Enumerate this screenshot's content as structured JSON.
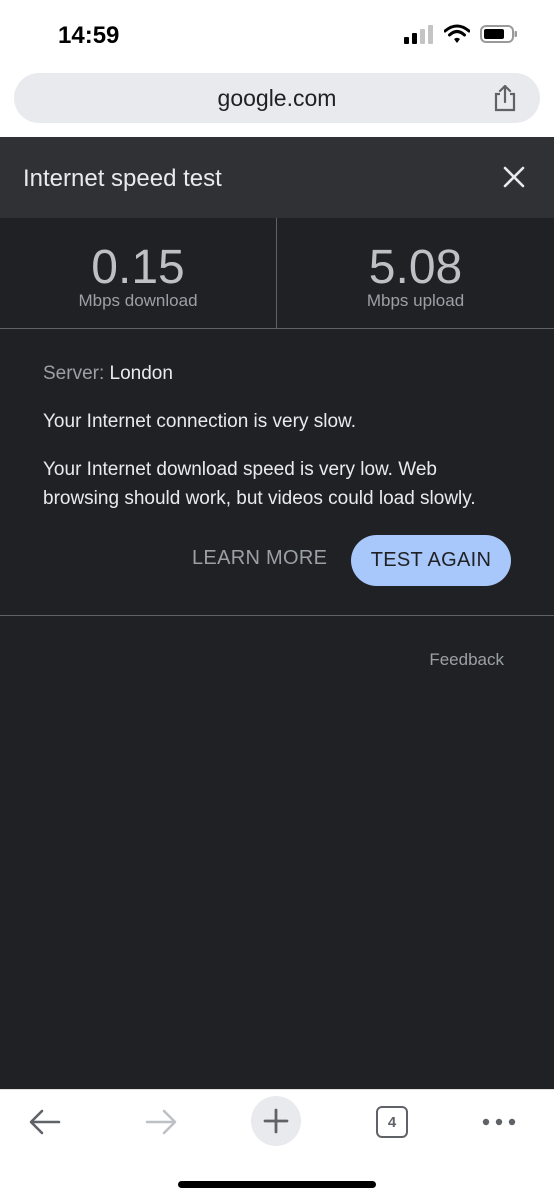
{
  "status_bar": {
    "time": "14:59"
  },
  "browser": {
    "url": "google.com",
    "tab_count": "4"
  },
  "speed_test": {
    "title": "Internet speed test",
    "download": {
      "value": "0.15",
      "unit": "Mbps download"
    },
    "upload": {
      "value": "5.08",
      "unit": "Mbps upload"
    },
    "server_label": "Server:",
    "server_value": "London",
    "message_1": "Your Internet connection is very slow.",
    "message_2": "Your Internet download speed is very low. Web browsing should work, but videos could load slowly.",
    "learn_more_label": "LEARN MORE",
    "test_again_label": "TEST AGAIN",
    "feedback_label": "Feedback"
  },
  "colors": {
    "panel_bg": "#202124",
    "header_bg": "#303134",
    "accent_button": "#a8c7fa"
  }
}
